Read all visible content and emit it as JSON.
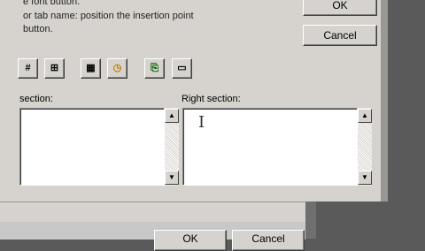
{
  "instructions": {
    "line1": "e font button.",
    "line2": "or tab name:  position the insertion point",
    "line3": "button."
  },
  "buttons": {
    "ok": "OK",
    "cancel": "Cancel"
  },
  "toolbar_icons": [
    {
      "name": "page-number-icon",
      "glyph": "#"
    },
    {
      "name": "total-pages-icon",
      "glyph": "⊞"
    },
    {
      "name": "date-icon",
      "glyph": "▦"
    },
    {
      "name": "time-icon",
      "glyph": "◷"
    },
    {
      "name": "file-name-icon",
      "glyph": "⎘"
    },
    {
      "name": "sheet-name-icon",
      "glyph": "▭"
    }
  ],
  "sections": {
    "center_label": "section:",
    "right_label": "Right section:"
  },
  "lower_dialog": {
    "ok": "OK",
    "cancel": "Cancel"
  }
}
